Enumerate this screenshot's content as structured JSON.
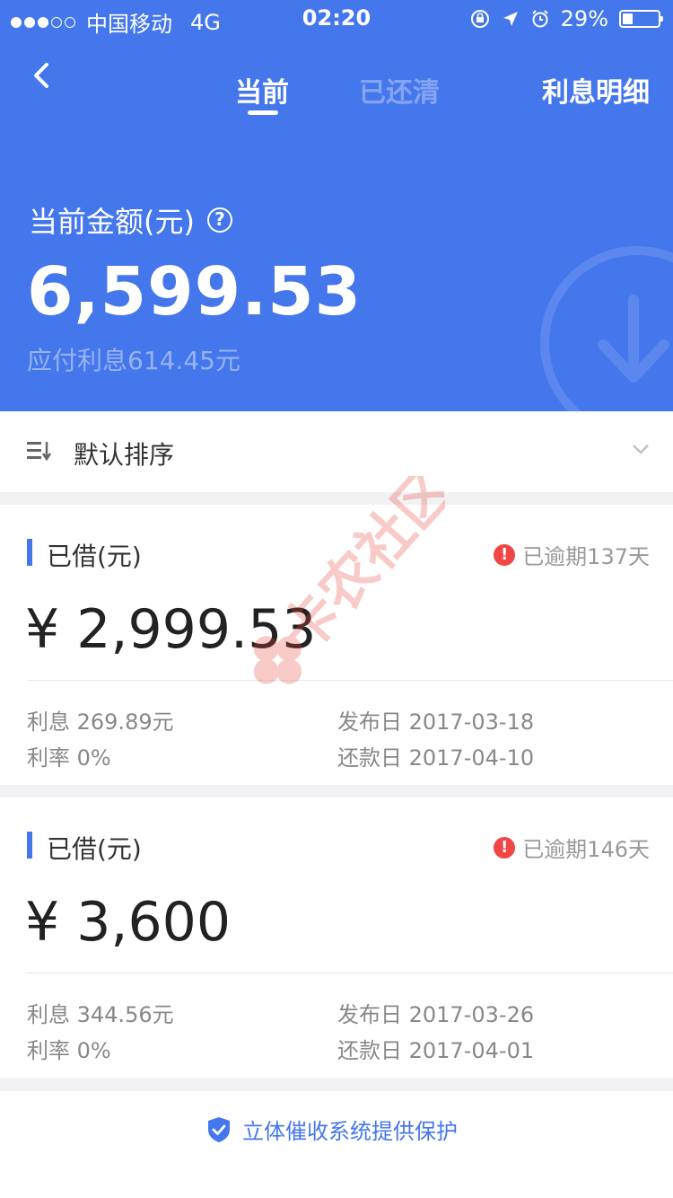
{
  "status_bar": {
    "carrier": "中国移动",
    "network": "4G",
    "time": "02:20",
    "battery_text": "29%",
    "battery_level": 0.29,
    "signal_full": 3,
    "signal_total": 5
  },
  "nav": {
    "tabs": [
      {
        "label": "当前",
        "active": true
      },
      {
        "label": "已还清",
        "active": false
      }
    ],
    "right_label": "利息明细"
  },
  "summary": {
    "label": "当前金额(元)",
    "help_symbol": "?",
    "amount": "6,599.53",
    "interest_due": "应付利息614.45元"
  },
  "sort": {
    "label": "默认排序"
  },
  "loans": [
    {
      "title": "已借(元)",
      "status": "已逾期137天",
      "amount": "¥ 2,999.53",
      "interest": "利息 269.89元",
      "rate": "利率 0%",
      "issue_date": "发布日 2017-03-18",
      "due_date": "还款日 2017-04-10"
    },
    {
      "title": "已借(元)",
      "status": "已逾期146天",
      "amount": "¥ 3,600",
      "interest": "利息 344.56元",
      "rate": "利率 0%",
      "issue_date": "发布日 2017-03-26",
      "due_date": "还款日 2017-04-01"
    }
  ],
  "footer": {
    "text": "立体催收系统提供保护"
  },
  "watermark": {
    "text": "卡农社区"
  },
  "colors": {
    "primary": "#4476ec",
    "warning": "#f04646"
  }
}
